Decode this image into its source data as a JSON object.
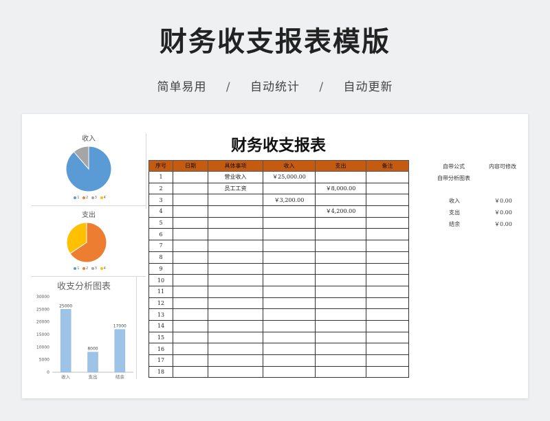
{
  "page": {
    "title": "财务收支报表模版",
    "features": [
      "简单易用",
      "自动统计",
      "自动更新"
    ],
    "separator": "/"
  },
  "sheet": {
    "title": "财务收支报表",
    "columns": [
      "序号",
      "日期",
      "具体事项",
      "收入",
      "支出",
      "备注"
    ],
    "rows": [
      {
        "no": "1",
        "date": "",
        "item": "营业收入",
        "income": "￥25,000.00",
        "expense": "",
        "note": ""
      },
      {
        "no": "2",
        "date": "",
        "item": "员工工资",
        "income": "",
        "expense": "￥8,000.00",
        "note": ""
      },
      {
        "no": "3",
        "date": "",
        "item": "",
        "income": "￥3,200.00",
        "expense": "",
        "note": ""
      },
      {
        "no": "4",
        "date": "",
        "item": "",
        "income": "",
        "expense": "￥4,200.00",
        "note": ""
      },
      {
        "no": "5",
        "date": "",
        "item": "",
        "income": "",
        "expense": "",
        "note": ""
      },
      {
        "no": "6",
        "date": "",
        "item": "",
        "income": "",
        "expense": "",
        "note": ""
      },
      {
        "no": "7",
        "date": "",
        "item": "",
        "income": "",
        "expense": "",
        "note": ""
      },
      {
        "no": "8",
        "date": "",
        "item": "",
        "income": "",
        "expense": "",
        "note": ""
      },
      {
        "no": "9",
        "date": "",
        "item": "",
        "income": "",
        "expense": "",
        "note": ""
      },
      {
        "no": "10",
        "date": "",
        "item": "",
        "income": "",
        "expense": "",
        "note": ""
      },
      {
        "no": "11",
        "date": "",
        "item": "",
        "income": "",
        "expense": "",
        "note": ""
      },
      {
        "no": "12",
        "date": "",
        "item": "",
        "income": "",
        "expense": "",
        "note": ""
      },
      {
        "no": "13",
        "date": "",
        "item": "",
        "income": "",
        "expense": "",
        "note": ""
      },
      {
        "no": "14",
        "date": "",
        "item": "",
        "income": "",
        "expense": "",
        "note": ""
      },
      {
        "no": "15",
        "date": "",
        "item": "",
        "income": "",
        "expense": "",
        "note": ""
      },
      {
        "no": "16",
        "date": "",
        "item": "",
        "income": "",
        "expense": "",
        "note": ""
      },
      {
        "no": "17",
        "date": "",
        "item": "",
        "income": "",
        "expense": "",
        "note": ""
      },
      {
        "no": "18",
        "date": "",
        "item": "",
        "income": "",
        "expense": "",
        "note": ""
      }
    ]
  },
  "side_notes": {
    "formula": "自带公式",
    "editable": "内容可修改",
    "charts": "自带分析图表",
    "summary": [
      {
        "label": "收入",
        "value": "￥0.00"
      },
      {
        "label": "支出",
        "value": "￥0.00"
      },
      {
        "label": "结余",
        "value": "￥0.00"
      }
    ]
  },
  "colors": {
    "header": "#c55a11",
    "pie1_blue": "#5b9bd5",
    "pie1_grey": "#a5a5a5",
    "pie2_orange": "#ed7d31",
    "pie2_yellow": "#ffc000",
    "bar": "#9dc3e6"
  },
  "chart_data": [
    {
      "type": "pie",
      "title": "收入",
      "legend": [
        "1",
        "2",
        "3",
        "4"
      ],
      "legend_colors": [
        "#5b9bd5",
        "#ed7d31",
        "#a5a5a5",
        "#ffc000"
      ],
      "values": [
        25000,
        0,
        3200,
        0
      ],
      "legend_position": "bottom"
    },
    {
      "type": "pie",
      "title": "支出",
      "legend": [
        "1",
        "2",
        "3",
        "4"
      ],
      "legend_colors": [
        "#5b9bd5",
        "#ed7d31",
        "#a5a5a5",
        "#ffc000"
      ],
      "values": [
        0,
        8000,
        0,
        4200
      ],
      "legend_position": "bottom"
    },
    {
      "type": "bar",
      "title": "收支分析图表",
      "categories": [
        "收入",
        "支出",
        "结余"
      ],
      "values": [
        25000,
        8000,
        17000
      ],
      "data_labels": [
        "25000",
        "8000",
        "17000"
      ],
      "yticks": [
        "0",
        "5000",
        "10000",
        "15000",
        "20000",
        "25000",
        "30000"
      ],
      "ylim": [
        0,
        30000
      ],
      "grid": false
    }
  ]
}
